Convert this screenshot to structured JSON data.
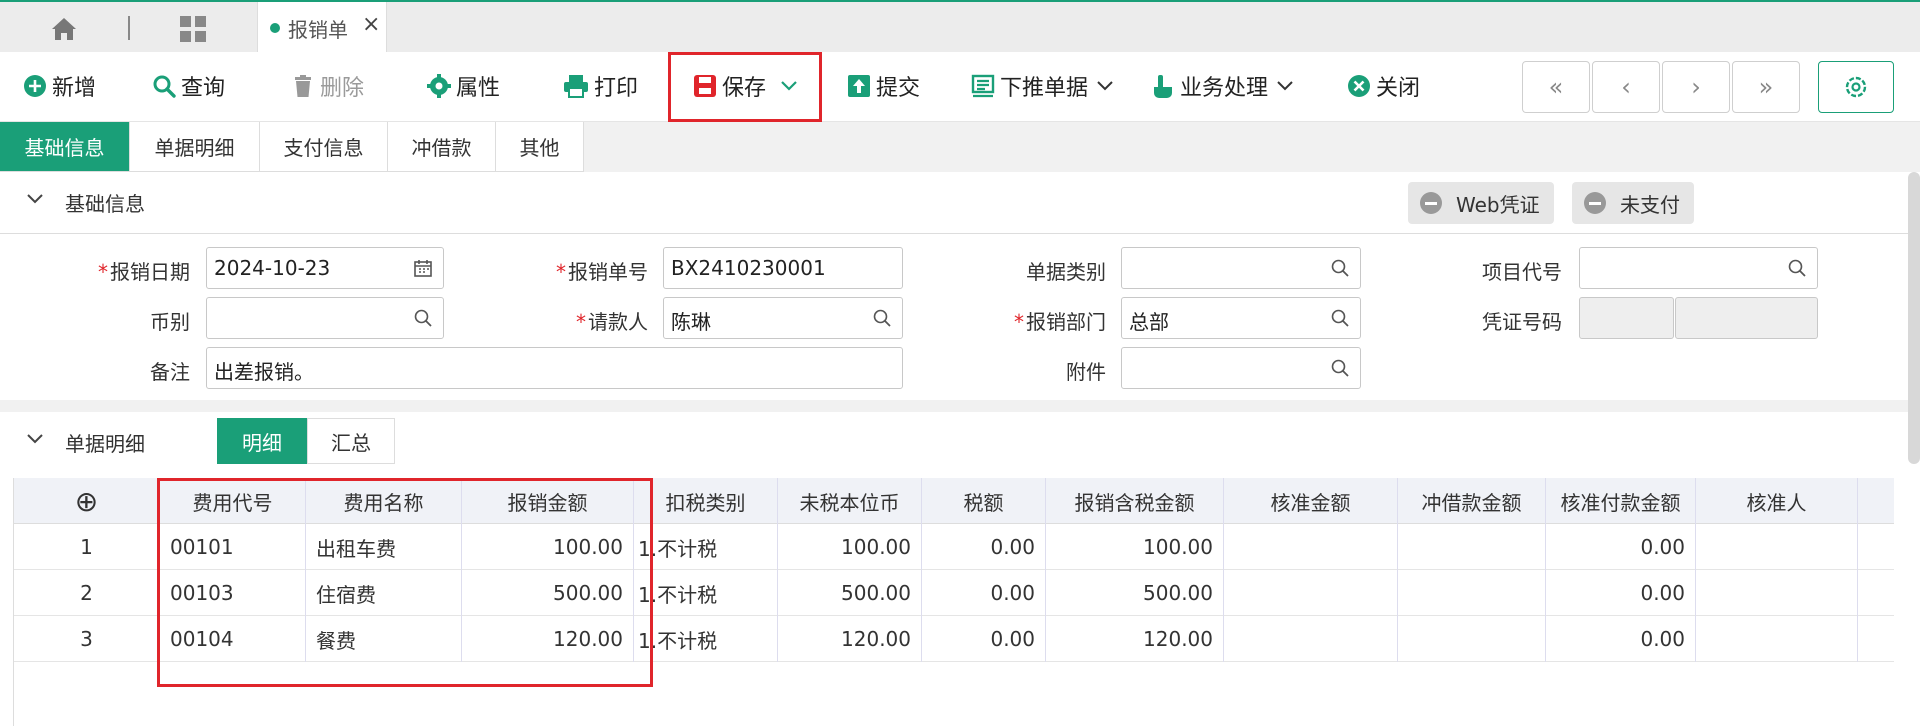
{
  "tabbar": {
    "icons": [
      "home-icon",
      "grid-icon"
    ],
    "active_tab": "报销单",
    "close_glyph": "×"
  },
  "toolbar": {
    "new": "新增",
    "query": "查询",
    "delete": "删除",
    "properties": "属性",
    "print": "打印",
    "save": "保存",
    "submit": "提交",
    "push_down": "下推单据",
    "business": "业务处理",
    "close": "关闭",
    "nav": [
      "«",
      "‹",
      "›",
      "»"
    ]
  },
  "section_tabs": [
    "基础信息",
    "单据明细",
    "支付信息",
    "冲借款",
    "其他"
  ],
  "basic": {
    "title": "基础信息",
    "web_voucher": "Web凭证",
    "payment_status": "未支付"
  },
  "form": {
    "date_label": "报销日期",
    "date_value": "2024-10-23",
    "no_label": "报销单号",
    "no_value": "BX2410230001",
    "type_label": "单据类别",
    "type_value": "",
    "project_label": "项目代号",
    "project_value": "",
    "currency_label": "币别",
    "currency_value": "",
    "requester_label": "请款人",
    "requester_value": "陈琳",
    "dept_label": "报销部门",
    "dept_value": "总部",
    "voucher_label": "凭证号码",
    "remark_label": "备注",
    "remark_value": "出差报销。",
    "attach_label": "附件",
    "attach_value": ""
  },
  "detail": {
    "title": "单据明细",
    "tab_detail": "明细",
    "tab_summary": "汇总",
    "add_glyph": "⊕",
    "columns": [
      "费用代号",
      "费用名称",
      "报销金额",
      "扣税类别",
      "未税本位币",
      "税额",
      "报销含税金额",
      "核准金额",
      "冲借款金额",
      "核准付款金额",
      "核准人"
    ],
    "rows": [
      {
        "idx": "1",
        "code": "00101",
        "name": "出租车费",
        "amount": "100.00",
        "tax_type": "1.不计税",
        "net": "100.00",
        "tax": "0.00",
        "gross": "100.00",
        "approved": "",
        "offset": "",
        "approved_pay": "0.00",
        "approver": ""
      },
      {
        "idx": "2",
        "code": "00103",
        "name": "住宿费",
        "amount": "500.00",
        "tax_type": "1.不计税",
        "net": "500.00",
        "tax": "0.00",
        "gross": "500.00",
        "approved": "",
        "offset": "",
        "approved_pay": "0.00",
        "approver": ""
      },
      {
        "idx": "3",
        "code": "00104",
        "name": "餐费",
        "amount": "120.00",
        "tax_type": "1.不计税",
        "net": "120.00",
        "tax": "0.00",
        "gross": "120.00",
        "approved": "",
        "offset": "",
        "approved_pay": "0.00",
        "approver": ""
      }
    ]
  },
  "colors": {
    "accent": "#1a9f78",
    "highlight": "#e0252b",
    "required": "#e0252b"
  }
}
